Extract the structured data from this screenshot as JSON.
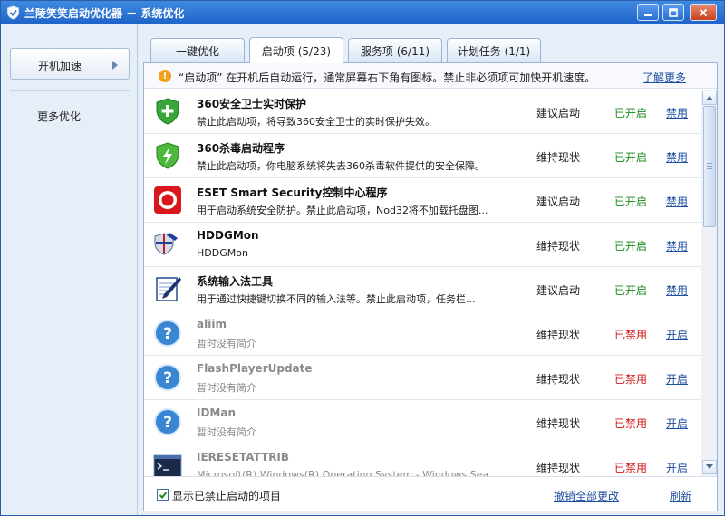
{
  "window": {
    "title": "兰陵笑笑启动优化器 － 系统优化"
  },
  "sidebar": {
    "primary_button": "开机加速",
    "secondary_link": "更多优化"
  },
  "tabs": [
    {
      "label": "一键优化"
    },
    {
      "label": "启动项 (5/23)"
    },
    {
      "label": "服务项 (6/11)"
    },
    {
      "label": "计划任务 (1/1)"
    }
  ],
  "notice": {
    "text": "“启动项” 在开机后自动运行，通常屏幕右下角有图标。禁止非必须项可加快开机速度。",
    "link": "了解更多"
  },
  "rows": [
    {
      "name": "360安全卫士实时保护",
      "desc": "禁止此启动项，将导致360安全卫士的实时保护失效。",
      "suggest": "建议启动",
      "status": "已开启",
      "action": "禁用",
      "enabled": true,
      "icon": "shield-plus-icon"
    },
    {
      "name": "360杀毒启动程序",
      "desc": "禁止此启动项，你电脑系统将失去360杀毒软件提供的安全保障。",
      "suggest": "维持现状",
      "status": "已开启",
      "action": "禁用",
      "enabled": true,
      "icon": "shield-bolt-icon"
    },
    {
      "name": "ESET Smart Security控制中心程序",
      "desc": "用于启动系统安全防护。禁止此启动项，Nod32将不加载托盘图...",
      "suggest": "建议启动",
      "status": "已开启",
      "action": "禁用",
      "enabled": true,
      "icon": "eset-eye-icon"
    },
    {
      "name": "HDDGMon",
      "desc": "HDDGMon",
      "suggest": "维持现状",
      "status": "已开启",
      "action": "禁用",
      "enabled": true,
      "icon": "hdd-guard-icon"
    },
    {
      "name": "系统输入法工具",
      "desc": "用于通过快捷键切换不同的输入法等。禁止此启动项，任务栏...",
      "suggest": "建议启动",
      "status": "已开启",
      "action": "禁用",
      "enabled": true,
      "icon": "pen-notepad-icon"
    },
    {
      "name": "aliim",
      "desc": "暂时没有简介",
      "suggest": "维持现状",
      "status": "已禁用",
      "action": "开启",
      "enabled": false,
      "icon": "question-icon"
    },
    {
      "name": "FlashPlayerUpdate",
      "desc": "暂时没有简介",
      "suggest": "维持现状",
      "status": "已禁用",
      "action": "开启",
      "enabled": false,
      "icon": "question-icon"
    },
    {
      "name": "IDMan",
      "desc": "暂时没有简介",
      "suggest": "维持现状",
      "status": "已禁用",
      "action": "开启",
      "enabled": false,
      "icon": "question-icon"
    },
    {
      "name": "IERESETATTRIB",
      "desc": "Microsoft(R) Windows(R) Operating System - Windows Sea...",
      "suggest": "维持现状",
      "status": "已禁用",
      "action": "开启",
      "enabled": false,
      "icon": "console-icon"
    }
  ],
  "footer": {
    "checkbox_label": "显示已禁止启动的项目",
    "checked": true,
    "undo_link": "撤销全部更改",
    "refresh_link": "刷新"
  },
  "colors": {
    "enabled": "#1a8a1a",
    "disabled": "#d11414",
    "link": "#1d4ea0"
  }
}
